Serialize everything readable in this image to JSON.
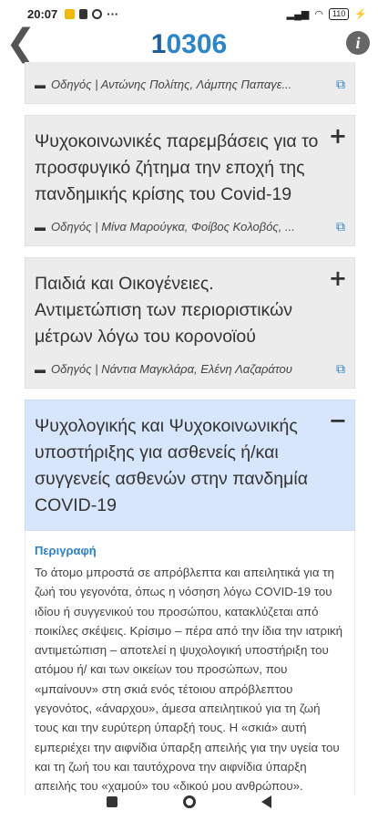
{
  "status_bar": {
    "time": "20:07",
    "more": "···",
    "battery": "110"
  },
  "app_bar": {
    "logo_prefix": "1",
    "logo_rest": "0306"
  },
  "cards": [
    {
      "author": "Οδηγός | Αντώνης Πολίτης, Λάμπης Παπαγε..."
    },
    {
      "title": "Ψυχοκοινωνικές παρεμβάσεις για το προσφυγικό ζήτημα την εποχή της πανδημικής κρίσης του Covid-19",
      "toggle": "+",
      "author": "Οδηγός | Μίνα Μαρούγκα, Φοίβος Κολοβός, ..."
    },
    {
      "title": "Παιδιά και Οικογένειες. Αντιμετώπιση των περιοριστικών μέτρων λόγω του κορονοϊού",
      "toggle": "+",
      "author": "Οδηγός | Νάντια Μαγκλάρα, Ελένη Λαζαράτου"
    },
    {
      "title": "Ψυχολογικής και Ψυχοκοινωνικής υποστήριξης για ασθενείς ή/και συγγενείς ασθενών στην πανδημία COVID-19",
      "toggle": "−"
    }
  ],
  "description": {
    "heading": "Περιγραφή",
    "text": "Το άτομο μπροστά σε απρόβλεπτα και απειλητικά για τη ζωή του γεγονότα, όπως η νόσηση λόγω COVID-19 του ιδίου ή συγγενικού του προσώπου, κατακλύζεται από ποικίλες σκέψεις. Κρίσιμο – πέρα από την ίδια την ιατρική αντιμετώπιση – αποτελεί η ψυχολογική υποστήριξη του ατόμου ή/ και των οικείων του προσώπων, που «μπαίνουν» στη σκιά ενός τέτοιου απρόβλεπτου γεγονότος, «άναρχου», άμεσα απειλητικού για τη ζωή τους και την ευρύτερη ύπαρξή τους. Η «σκιά» αυτή εμπεριέχει την αιφνίδια ύπαρξη απειλής για την υγεία του και τη ζωή του και ταυτόχρονα την αιφνίδια ύπαρξη απειλής του «χαμού» του «δικού μου ανθρώπου»."
  }
}
